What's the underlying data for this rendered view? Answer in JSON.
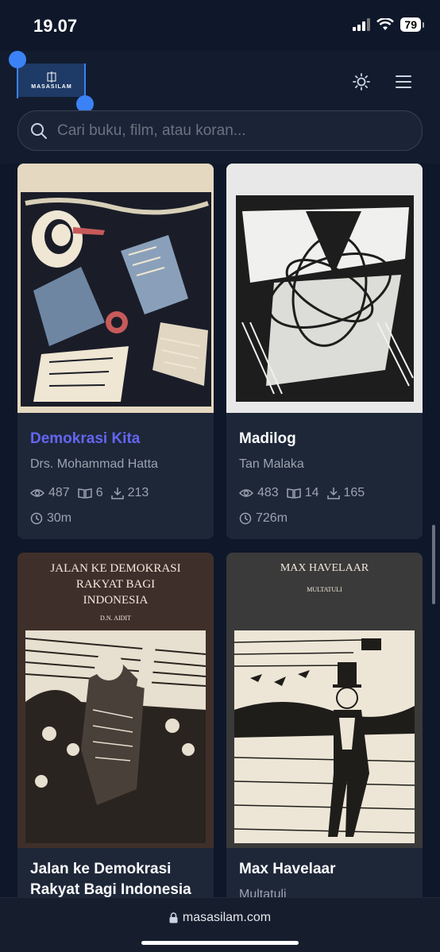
{
  "status": {
    "time": "19.07",
    "battery": "79"
  },
  "header": {
    "logo_text": "MASASILAM",
    "search": {
      "placeholder": "Cari buku, film, atau koran...",
      "value": ""
    }
  },
  "books": [
    {
      "title": "Demokrasi Kita",
      "author": "Drs. Mohammad Hatta",
      "views": "487",
      "pages": "6",
      "downloads": "213",
      "duration": "30m"
    },
    {
      "title": "Madilog",
      "author": "Tan Malaka",
      "views": "483",
      "pages": "14",
      "downloads": "165",
      "duration": "726m"
    },
    {
      "title": "Jalan ke Demokrasi Rakyat Bagi Indonesia",
      "cover_title": "JALAN KE DEMOKRASI RAKYAT BAGI INDONESIA",
      "cover_author": "D.N. AIDIT"
    },
    {
      "title": "Max Havelaar",
      "author": "Multatuli",
      "cover_title": "MAX HAVELAAR",
      "cover_author": "MULTATULI"
    }
  ],
  "browser": {
    "url": "masasilam.com"
  },
  "colors": {
    "accent": "#6366f1",
    "background": "#0f172a",
    "card": "#1e2738"
  }
}
